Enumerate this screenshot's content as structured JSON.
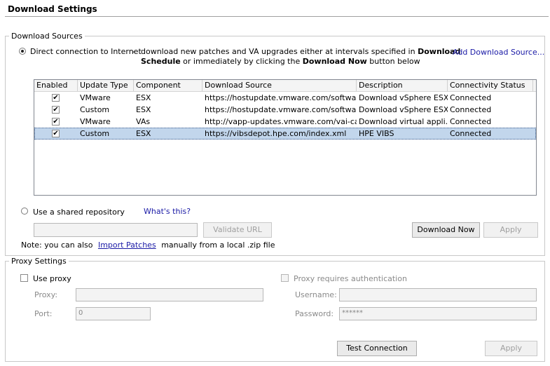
{
  "page": {
    "title": "Download Settings"
  },
  "sources": {
    "legend": "Download Sources",
    "direct_label": "Direct connection to Internet",
    "dash": "-",
    "desc_part1": "download new patches and VA upgrades either at intervals specified in",
    "desc_bold1": "Download",
    "desc_bold2": "Schedule",
    "desc_part2": "or immediately by clicking the",
    "desc_bold3": "Download Now",
    "desc_part3": "button below",
    "add_link": "Add Download Source...",
    "table": {
      "headers": [
        "Enabled",
        "Update Type",
        "Component",
        "Download Source",
        "Description",
        "Connectivity Status"
      ],
      "rows": [
        {
          "enabled": true,
          "update_type": "VMware",
          "component": "ESX",
          "source": "https://hostupdate.vmware.com/software/V...",
          "description": "Download vSphere ESX...",
          "status": "Connected"
        },
        {
          "enabled": true,
          "update_type": "Custom",
          "component": "ESX",
          "source": "https://hostupdate.vmware.com/software/V...",
          "description": "Download vSphere ESX...",
          "status": "Connected"
        },
        {
          "enabled": true,
          "update_type": "VMware",
          "component": "VAs",
          "source": "http://vapp-updates.vmware.com/vai-catal...",
          "description": "Download virtual appli...",
          "status": "Connected"
        },
        {
          "enabled": true,
          "update_type": "Custom",
          "component": "ESX",
          "source": "https://vibsdepot.hpe.com/index.xml",
          "description": "HPE VIBS",
          "status": "Connected"
        }
      ]
    },
    "shared_label": "Use a shared repository",
    "whats_this": "What's this?",
    "repo_url_value": "",
    "validate_button": "Validate URL",
    "download_now_button": "Download Now",
    "apply_button": "Apply",
    "note_prefix": "Note: you can also",
    "import_link": "Import Patches",
    "note_suffix": "manually from a local .zip file"
  },
  "proxy": {
    "legend": "Proxy Settings",
    "use_proxy_label": "Use proxy",
    "proxy_label": "Proxy:",
    "proxy_value": "",
    "port_label": "Port:",
    "port_value": "0",
    "auth_label": "Proxy requires authentication",
    "username_label": "Username:",
    "username_value": "",
    "password_label": "Password:",
    "password_value": "******",
    "test_button": "Test Connection",
    "apply_button": "Apply"
  }
}
